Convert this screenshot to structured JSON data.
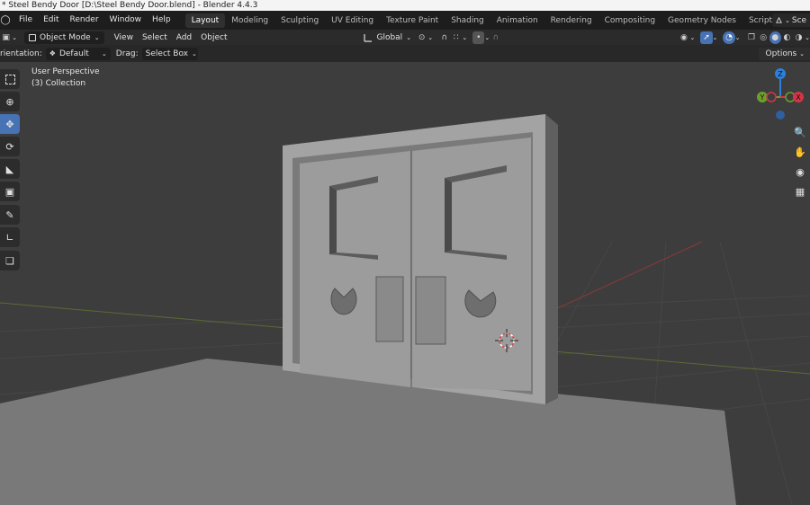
{
  "titlebar": {
    "text": "* Steel Bendy Door [D:\\Steel Bendy Door.blend] - Blender 4.4.3"
  },
  "menu": {
    "items": [
      "File",
      "Edit",
      "Render",
      "Window",
      "Help"
    ]
  },
  "workspaces": {
    "tabs": [
      "Layout",
      "Modeling",
      "Sculpting",
      "UV Editing",
      "Texture Paint",
      "Shading",
      "Animation",
      "Rendering",
      "Compositing",
      "Geometry Nodes",
      "Scripting"
    ],
    "active": "Layout",
    "add_symbol": "+"
  },
  "scene": {
    "label": "Sce"
  },
  "header": {
    "mode": "Object Mode",
    "menus": [
      "View",
      "Select",
      "Add",
      "Object"
    ],
    "transform_orientation": "Global"
  },
  "tool_settings": {
    "orientation_label": "rientation:",
    "orientation_value": "Default",
    "drag_label": "Drag:",
    "drag_value": "Select Box",
    "options_label": "Options"
  },
  "viewport": {
    "perspective": "User Perspective",
    "collection": "(3) Collection"
  },
  "gizmo": {
    "z": "Z",
    "y": "Y",
    "x": "X"
  },
  "colors": {
    "accent": "#4772b3",
    "x_axis": "#d63447",
    "y_axis": "#6ba02a",
    "z_axis": "#2f7fd9",
    "background": "#3d3d3d"
  },
  "icons": {
    "toolbar": [
      "select-box-icon",
      "cursor-icon",
      "move-icon",
      "rotate-icon",
      "scale-icon",
      "transform-icon",
      "annotate-icon",
      "measure-icon",
      "add-cube-icon"
    ],
    "nav": [
      "zoom-icon",
      "hand-pan-icon",
      "camera-icon",
      "grid-ortho-icon"
    ]
  }
}
